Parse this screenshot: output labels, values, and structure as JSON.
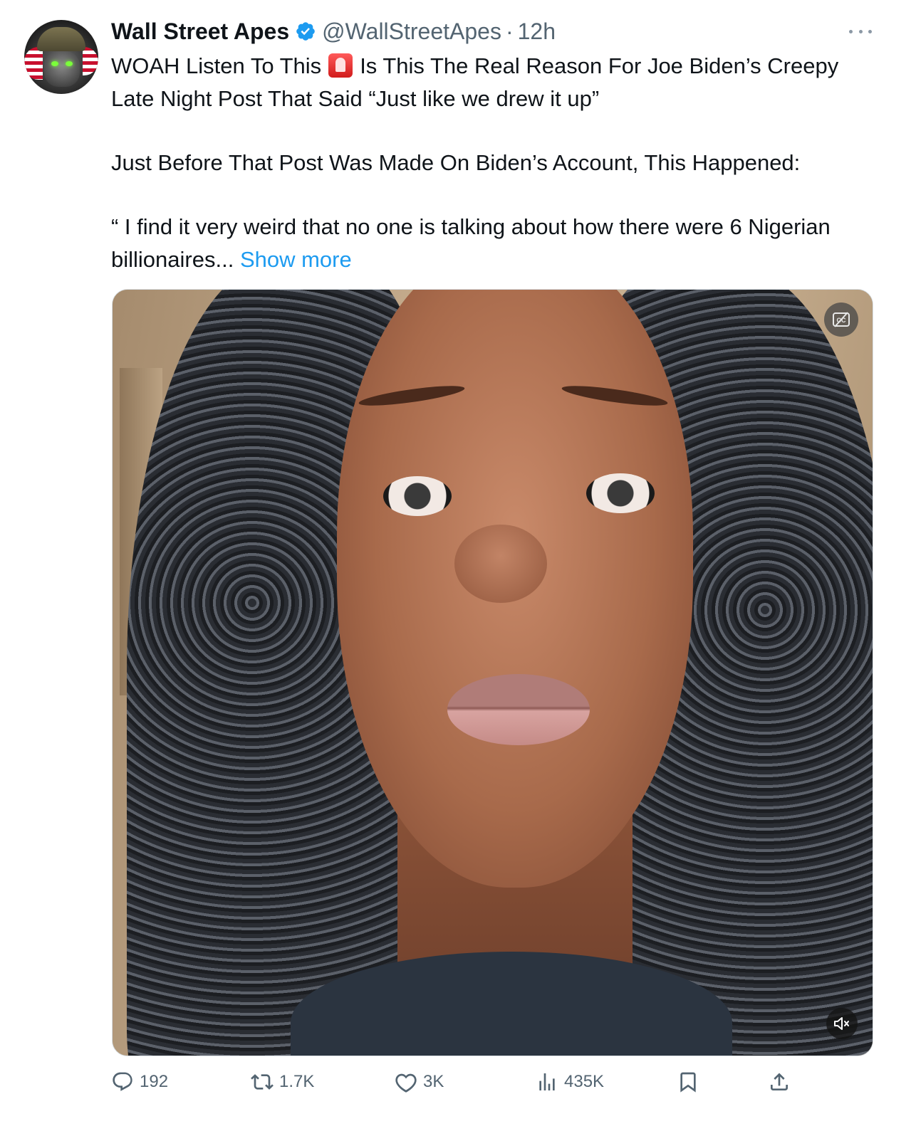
{
  "tweet": {
    "author_name": "Wall Street Apes",
    "handle": "@WallStreetApes",
    "separator": "·",
    "time": "12h",
    "line1_a": "WOAH Listen To This",
    "line1_b": "Is This The Real Reason For Joe Biden’s Creepy Late Night Post That Said “Just like we drew it up”",
    "para2": "Just Before That Post Was Made On Biden’s Account, This Happened:",
    "para3": "“ I find it very weird that no one is talking about how there were 6 Nigerian billionaires...",
    "show_more": "Show more"
  },
  "actions": {
    "replies": "192",
    "reposts": "1.7K",
    "likes": "3K",
    "views": "435K"
  },
  "icons": {
    "verified": "verified-badge-icon",
    "emoji": "police-siren-emoji",
    "more": "more-options-icon",
    "captions": "captions-icon",
    "mute": "muted-speaker-icon",
    "reply": "reply-icon",
    "repost": "repost-icon",
    "like": "heart-icon",
    "views": "views-icon",
    "bookmark": "bookmark-icon",
    "share": "share-icon"
  },
  "colors": {
    "link": "#1d9bf0",
    "verified": "#1d9bf0",
    "secondary_text": "#536471"
  }
}
